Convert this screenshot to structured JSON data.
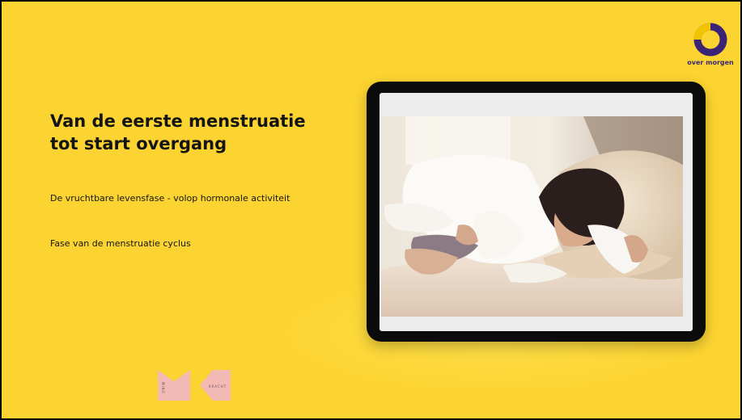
{
  "brand": {
    "logo_text": "over morgen",
    "colors": {
      "background": "#fcd431",
      "logo_purple": "#3b2476",
      "logo_yellow": "#f2c400",
      "text": "#141414"
    }
  },
  "slide": {
    "title_line1": "Van de eerste menstruatie",
    "title_line2": "tot start overgang",
    "bullets": [
      "De vruchtbare levensfase - volop hormonale activiteit",
      "Fase van de menstruatie cyclus"
    ]
  },
  "tablet": {
    "photo_icon": "woman-lying-in-bed-with-stomach-pain-photo"
  },
  "footer_logo": {
    "left_text": "MINO",
    "right_text": "KRACHT"
  }
}
